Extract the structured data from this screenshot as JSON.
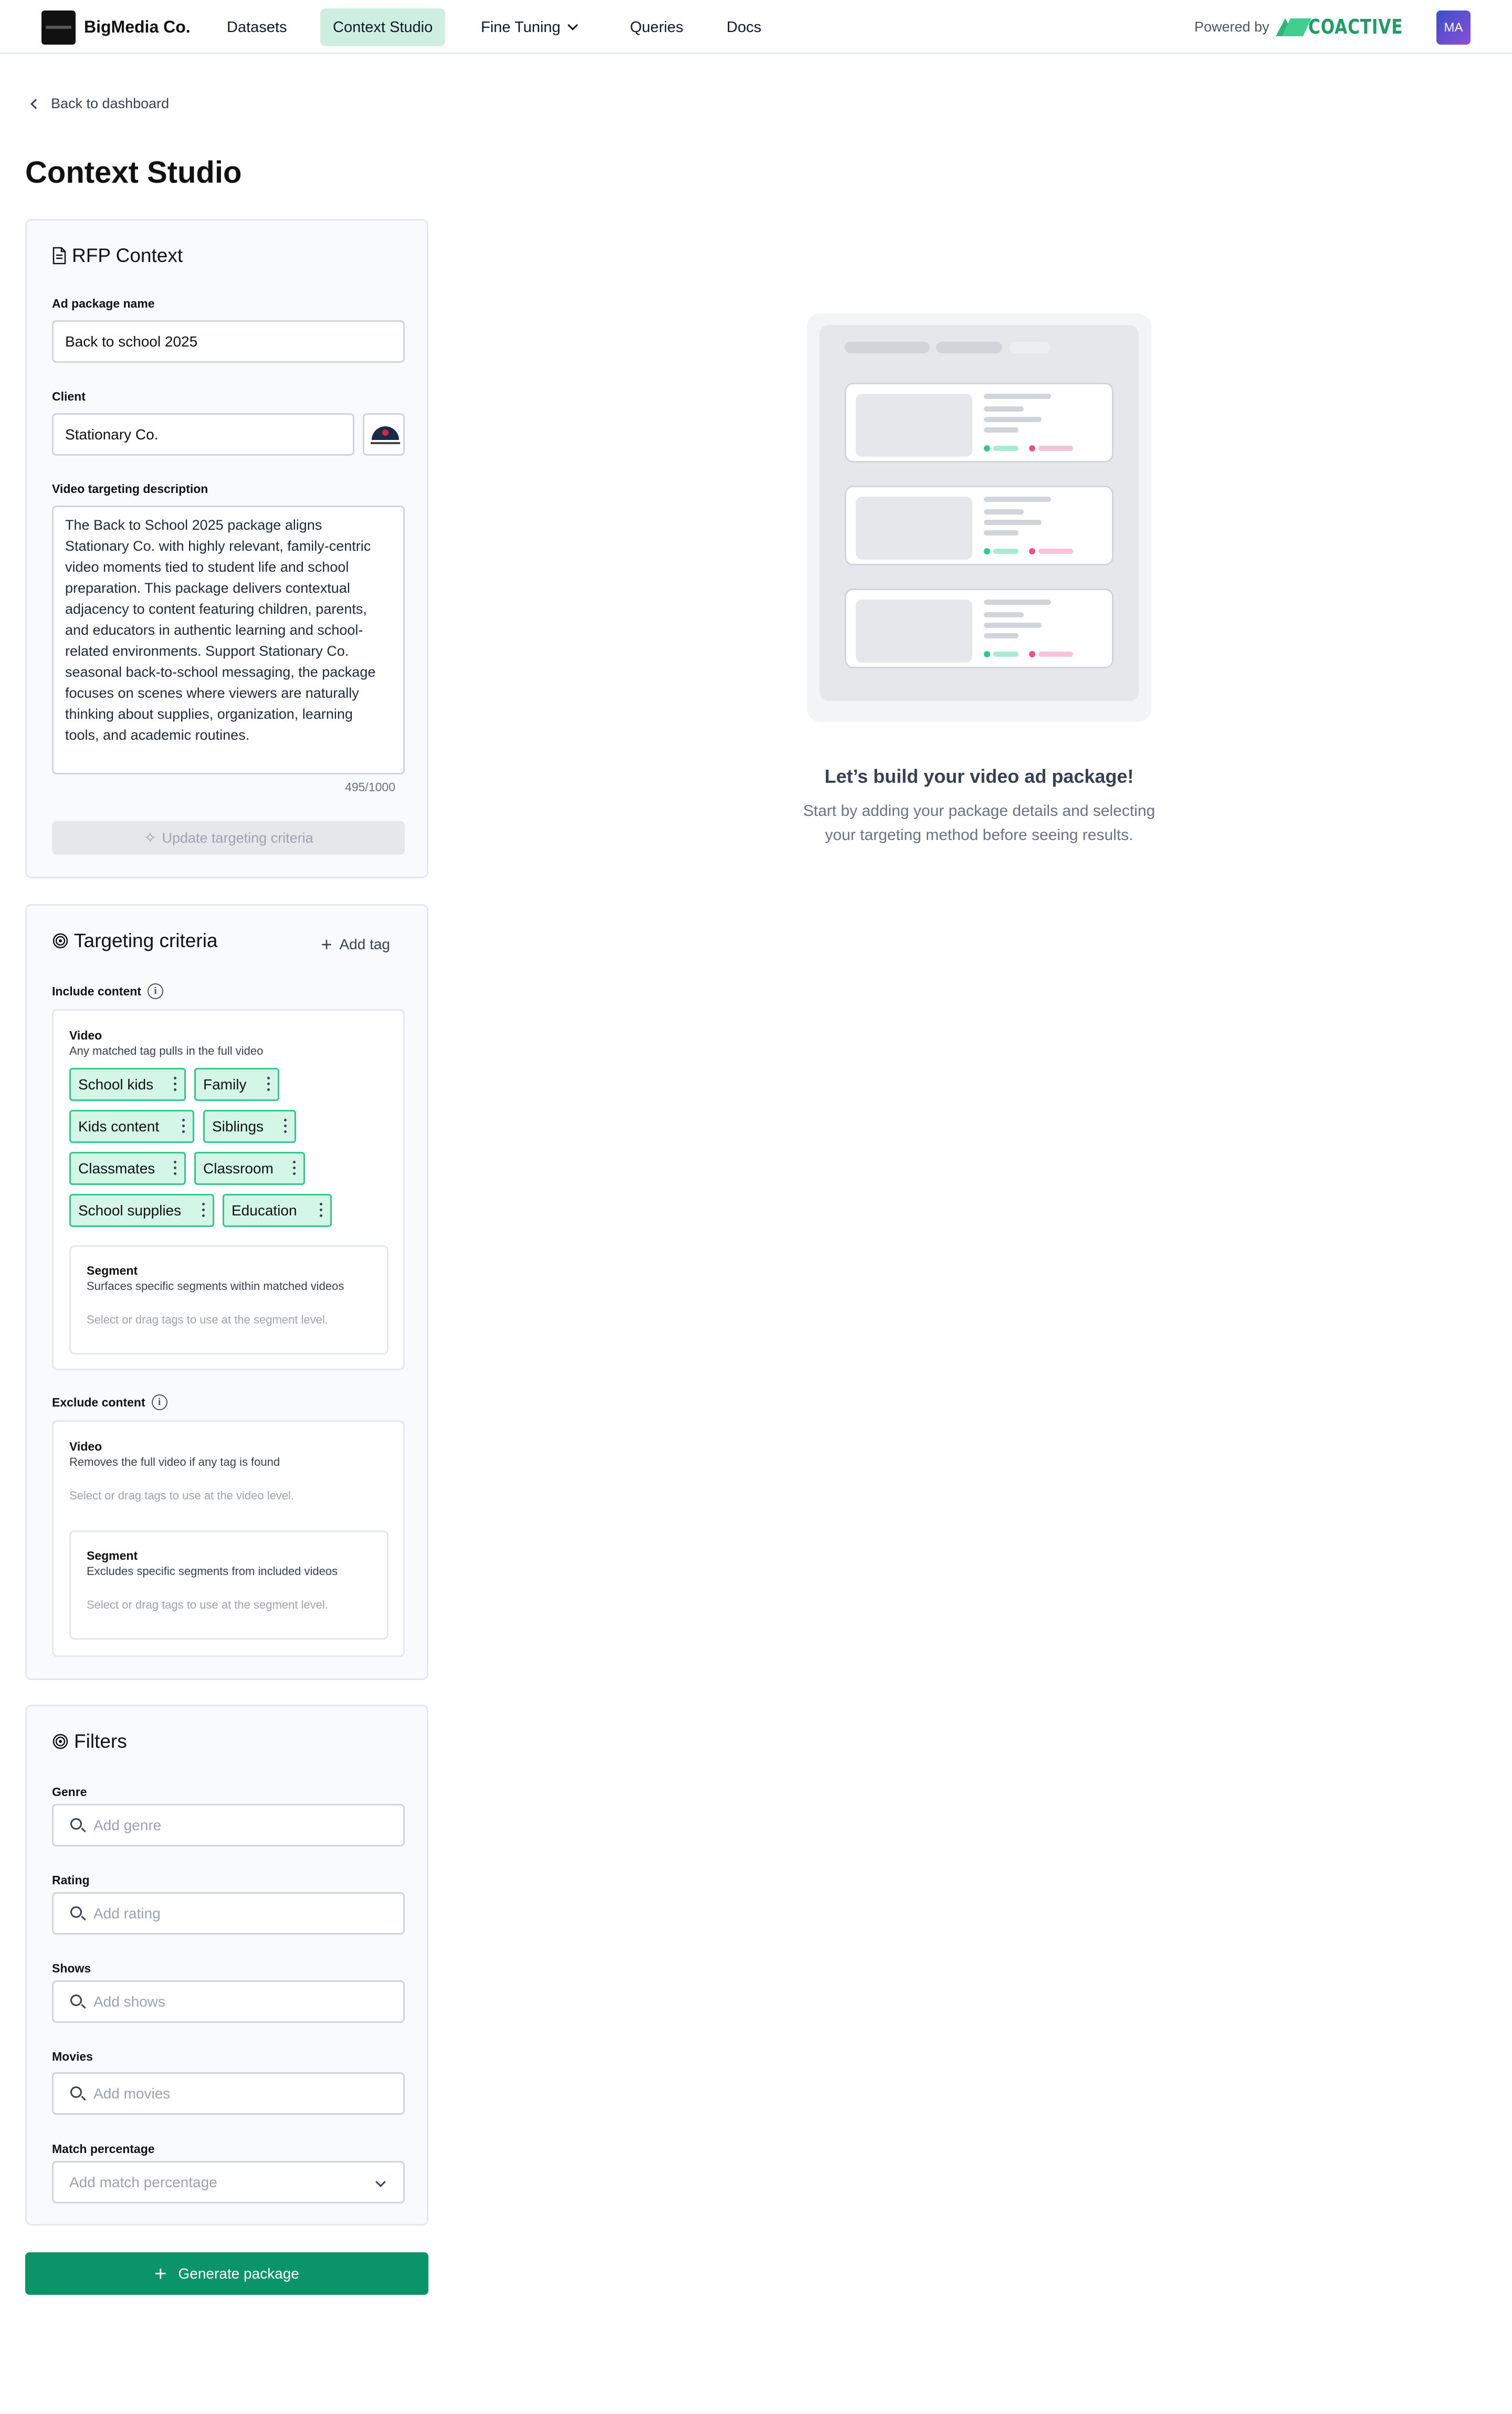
{
  "nav": {
    "brand": "BigMedia Co.",
    "items": [
      "Datasets",
      "Context Studio",
      "Fine Tuning",
      "Queries",
      "Docs"
    ],
    "powered_by": "Powered by",
    "partner": "COACTIVE",
    "avatar_initials": "MA",
    "accent": "#cfeee2"
  },
  "back_label": "Back to dashboard",
  "page_title": "Context Studio",
  "rfp": {
    "title": "RFP Context",
    "package_name_label": "Ad package name",
    "package_name_value": "Back to school 2025",
    "client_label": "Client",
    "client_value": "Stationary Co.",
    "description_label": "Video targeting description",
    "description_lines": [
      "The Back to School 2025 package aligns",
      "Stationary Co. with highly relevant, family-centric",
      "video moments tied to student life and school",
      "preparation. This package delivers contextual",
      "adjacency to content featuring children, parents,",
      "and educators in authentic learning and school-",
      "related environments. Support Stationary Co.",
      "seasonal back-to-school messaging, the package",
      "focuses on scenes where viewers are naturally",
      "thinking about supplies, organization, learning",
      "tools, and academic routines."
    ],
    "char_count": "495/1000",
    "update_button": "Update targeting criteria"
  },
  "targeting": {
    "title": "Targeting criteria",
    "add_tag": "Add tag",
    "include_label": "Include content",
    "include_video_title": "Video",
    "include_video_sub": "Any matched tag pulls in the full video",
    "tags": [
      "School kids",
      "Family",
      "Kids content",
      "Siblings",
      "Classmates",
      "Classroom",
      "School supplies",
      "Education"
    ],
    "include_segment_title": "Segment",
    "include_segment_sub": "Surfaces specific segments within matched videos",
    "include_segment_hint": "Select or drag tags to use at the segment level.",
    "exclude_label": "Exclude content",
    "exclude_video_title": "Video",
    "exclude_video_sub": "Removes the full video if any tag is found",
    "exclude_video_hint": "Select or drag tags to use at the video level.",
    "exclude_segment_title": "Segment",
    "exclude_segment_sub": "Excludes specific segments from included videos",
    "exclude_segment_hint": "Select or drag tags to use at the segment level."
  },
  "filters": {
    "title": "Filters",
    "genre_label": "Genre",
    "genre_placeholder": "Add genre",
    "rating_label": "Rating",
    "rating_placeholder": "Add rating",
    "shows_label": "Shows",
    "shows_placeholder": "Add shows",
    "movies_label": "Movies",
    "movies_placeholder": "Add movies",
    "match_label": "Match percentage",
    "match_placeholder": "Add match percentage"
  },
  "generate_button": "Generate package",
  "empty_state": {
    "title": "Let’s build your video ad package!",
    "subtitle_lines": [
      "Start by adding your package details and selecting",
      "your targeting method before seeing results."
    ]
  },
  "colors": {
    "primary": "#0a9468",
    "tag_bg": "#d4f6e6",
    "tag_border": "#34c98b"
  }
}
